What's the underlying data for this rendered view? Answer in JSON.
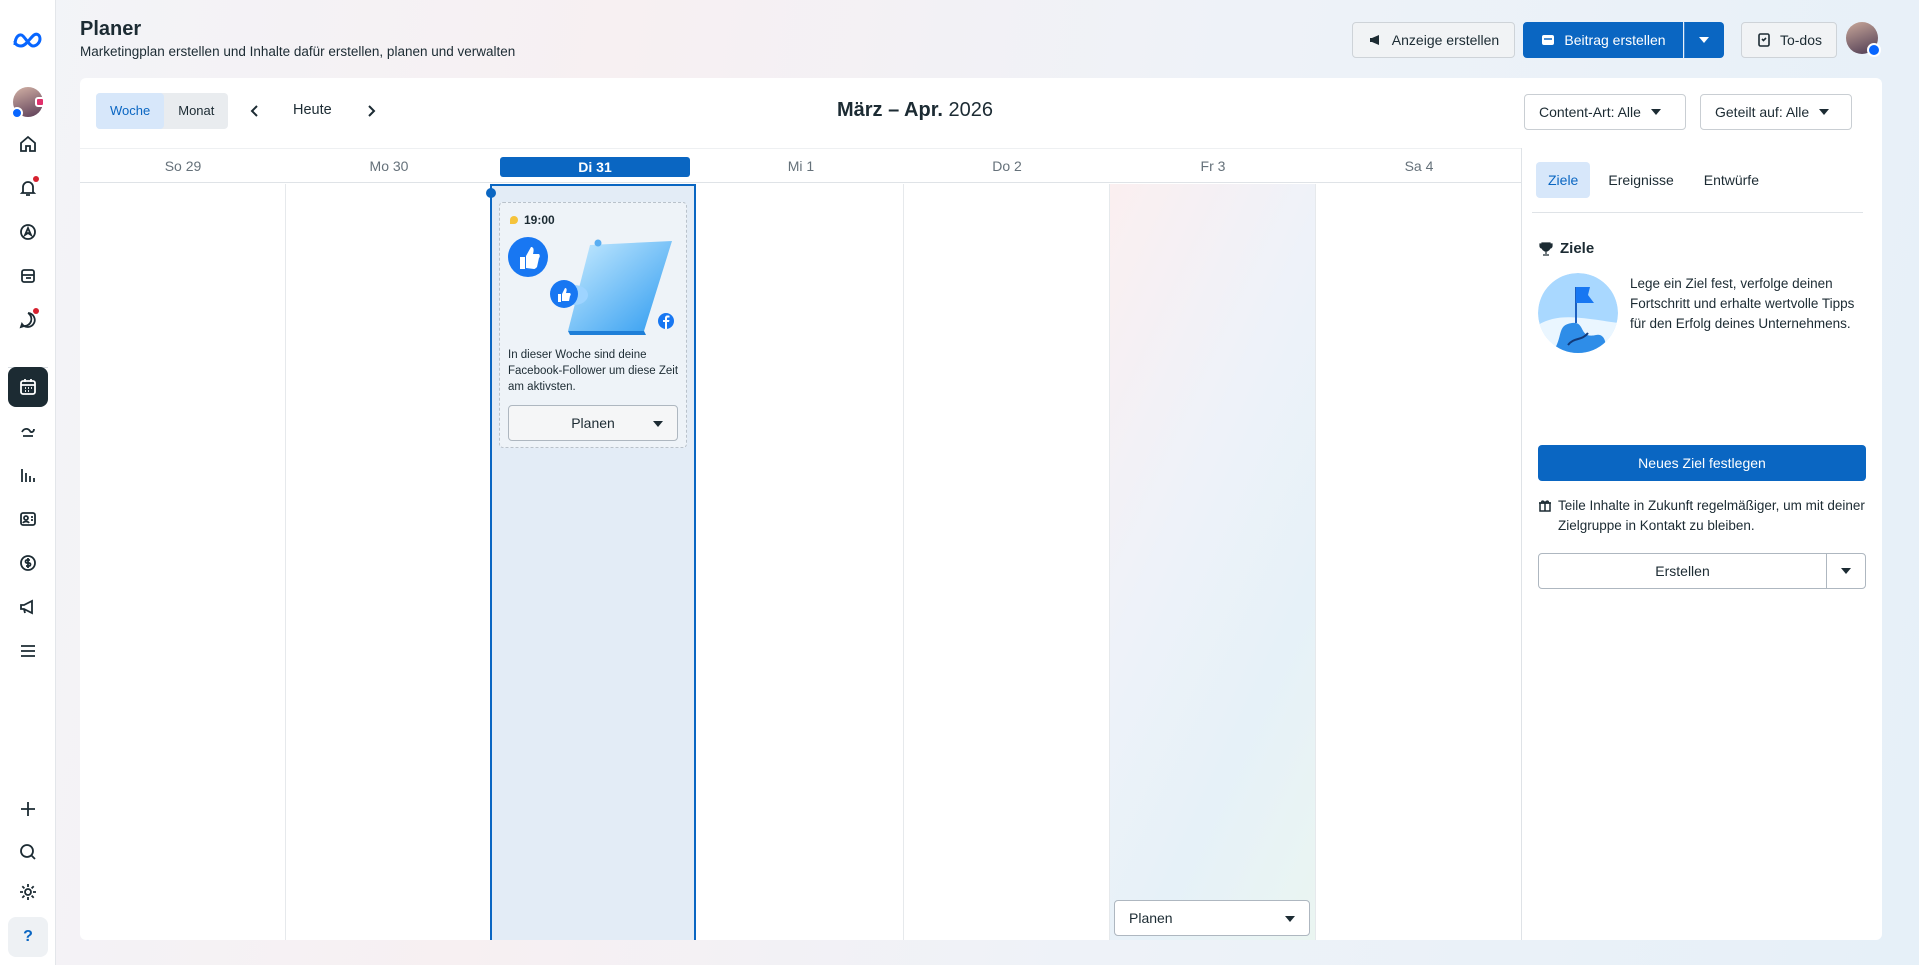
{
  "header": {
    "title": "Planer",
    "subtitle": "Marketingplan erstellen und Inhalte dafür erstellen, planen und verwalten",
    "create_ad": "Anzeige erstellen",
    "create_post": "Beitrag erstellen",
    "todos": "To-dos"
  },
  "toolbar": {
    "view_week": "Woche",
    "view_month": "Monat",
    "today": "Heute",
    "range_month": "März – Apr.",
    "range_year": "2026",
    "content_type": "Content-Art: Alle",
    "shared_on": "Geteilt auf: Alle"
  },
  "days": [
    {
      "label": "So 29"
    },
    {
      "label": "Mo 30"
    },
    {
      "label": "Di 31",
      "today": true
    },
    {
      "label": "Mi 1"
    },
    {
      "label": "Do 2"
    },
    {
      "label": "Fr 3"
    },
    {
      "label": "Sa 4"
    }
  ],
  "suggestion": {
    "time": "19:00",
    "text": "In dieser Woche sind deine Facebook-Follower um diese Zeit am aktivsten.",
    "button": "Planen"
  },
  "friday_button": "Planen",
  "panel": {
    "tabs": [
      "Ziele",
      "Ereignisse",
      "Entwürfe"
    ],
    "active_tab": "Ziele",
    "goal_title": "Ziele",
    "goal_text": "Lege ein Ziel fest, verfolge deinen Fortschritt und erhalte wertvolle Tipps für den Erfolg deines Unternehmens.",
    "goal_button": "Neues Ziel festlegen",
    "tip_text": "Teile Inhalte in Zukunft regelmäßiger, um mit deiner Zielgruppe in Kontakt zu bleiben.",
    "create_button": "Erstellen"
  },
  "rail_icons": [
    "meta-logo-icon",
    "account-avatar",
    "home-icon",
    "notifications-icon",
    "compass-icon",
    "content-icon",
    "inbox-icon",
    "planner-icon",
    "insights-icon",
    "analytics-icon",
    "contacts-icon",
    "monetization-icon",
    "ads-icon",
    "menu-icon",
    "add-icon",
    "search-icon",
    "settings-icon",
    "help-icon"
  ],
  "colors": {
    "accent": "#0a66c2",
    "text": "#1c2b33",
    "notification": "#d6212f"
  }
}
